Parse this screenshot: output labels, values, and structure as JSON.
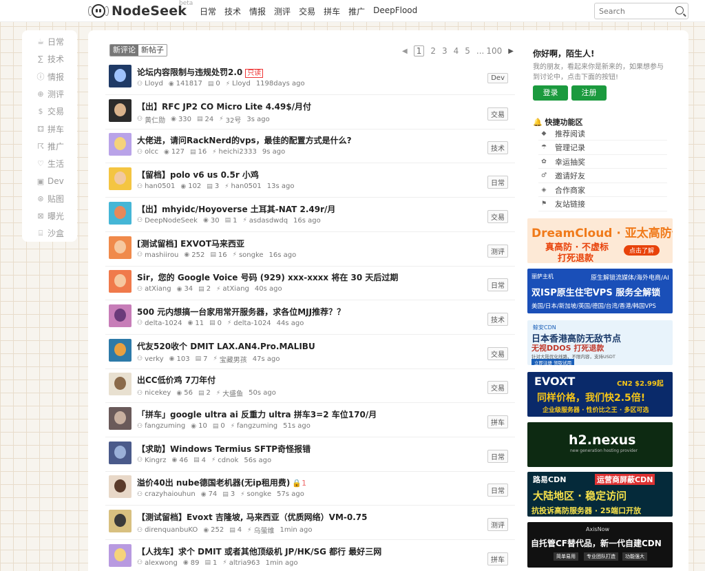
{
  "header": {
    "logo": "NodeSeek",
    "beta": "beta",
    "nav": [
      "日常",
      "技术",
      "情报",
      "测评",
      "交易",
      "拼车",
      "推广",
      "DeepFlood"
    ],
    "search_placeholder": "Search"
  },
  "sidebar": {
    "items": [
      {
        "icon": "☕",
        "label": "日常"
      },
      {
        "icon": "∑",
        "label": "技术"
      },
      {
        "icon": "ⓘ",
        "label": "情报"
      },
      {
        "icon": "⊕",
        "label": "测评"
      },
      {
        "icon": "$",
        "label": "交易"
      },
      {
        "icon": "⚃",
        "label": "拼车"
      },
      {
        "icon": "☈",
        "label": "推广"
      },
      {
        "icon": "♡",
        "label": "生活"
      },
      {
        "icon": "▣",
        "label": "Dev"
      },
      {
        "icon": "⊛",
        "label": "贴图"
      },
      {
        "icon": "⊠",
        "label": "曝光"
      },
      {
        "icon": "⌸",
        "label": "沙盒"
      }
    ]
  },
  "tabs": [
    "新评论",
    "新帖子"
  ],
  "pager": {
    "pages": [
      "1",
      "2",
      "3",
      "4",
      "5"
    ],
    "ellipsis": "...",
    "last": "100"
  },
  "posts": [
    {
      "title": "论坛内容限制与违规处罚2.0",
      "badge": "只读",
      "author": "Lloyd",
      "views": "141817",
      "comments": "0",
      "last": "Lloyd",
      "time": "1198days ago",
      "tag": "Dev",
      "avatar_color": "#1f3a66",
      "avatar_fg": "#9fc3ff"
    },
    {
      "title": "【出】RFC JP2 CO Micro Lite 4.49$/月付",
      "author": "黄仁勋",
      "views": "330",
      "comments": "24",
      "last": "32号",
      "time": "3s ago",
      "tag": "交易",
      "avatar_color": "#2b2b2b",
      "avatar_fg": "#d9b38c"
    },
    {
      "title": "大佬进，请问RackNerd的vps，最佳的配置方式是什么?",
      "author": "olcc",
      "views": "127",
      "comments": "16",
      "last": "heichi2333",
      "time": "9s ago",
      "tag": "技术",
      "avatar_color": "#b9a3e8",
      "avatar_fg": "#f5d37a"
    },
    {
      "title": "【留档】polo v6 us 0.5r 小鸡",
      "author": "han0501",
      "views": "102",
      "comments": "3",
      "last": "han0501",
      "time": "13s ago",
      "tag": "日常",
      "avatar_color": "#f4c542",
      "avatar_fg": "#f2c9a0"
    },
    {
      "title": "【出】mhyidc/Hoyoverse 土耳其-NAT 2.49r/月",
      "author": "DeepNodeSeek",
      "views": "30",
      "comments": "1",
      "last": "asdasdwdq",
      "time": "16s ago",
      "tag": "交易",
      "avatar_color": "#45b6d6",
      "avatar_fg": "#e8885a"
    },
    {
      "title": "[测试留档] EXVOT马来西亚",
      "author": "mashiirou",
      "views": "252",
      "comments": "16",
      "last": "songke",
      "time": "16s ago",
      "tag": "测评",
      "avatar_color": "#f08a4b",
      "avatar_fg": "#f6c8a0"
    },
    {
      "title": "Sir，您的 Google Voice 号码 (929) xxx-xxxx 将在 30 天后过期",
      "author": "atXiang",
      "views": "34",
      "comments": "2",
      "last": "atXiang",
      "time": "40s ago",
      "tag": "日常",
      "avatar_color": "#f07a4b",
      "avatar_fg": "#f6c8a0"
    },
    {
      "title": "500 元内想搞一台家用常开服务器，求各位MJJ推荐？？",
      "author": "delta-1024",
      "views": "11",
      "comments": "0",
      "last": "delta-1024",
      "time": "44s ago",
      "tag": "技术",
      "avatar_color": "#c77db8",
      "avatar_fg": "#6b3b7a"
    },
    {
      "title": "代友520收个 DMIT LAX.AN4.Pro.MALIBU",
      "author": "verky",
      "views": "103",
      "comments": "7",
      "last": "宝藏男孩",
      "time": "47s ago",
      "tag": "交易",
      "avatar_color": "#2d7aa8",
      "avatar_fg": "#e8a040"
    },
    {
      "title": "出CC低价鸡 7刀年付",
      "author": "nicekey",
      "views": "56",
      "comments": "2",
      "last": "大盛鱼",
      "time": "50s ago",
      "tag": "交易",
      "avatar_color": "#e8e0d0",
      "avatar_fg": "#8a6a4a"
    },
    {
      "title": "「拼车」google ultra ai 反重力 ultra 拼车3=2 车位170/月",
      "author": "fangzuming",
      "views": "10",
      "comments": "0",
      "last": "fangzuming",
      "time": "51s ago",
      "tag": "拼车",
      "avatar_color": "#6a5a5a",
      "avatar_fg": "#c8b0a0"
    },
    {
      "title": "【求助】Windows Termius SFTP奇怪报错",
      "author": "Kingrz",
      "views": "46",
      "comments": "4",
      "last": "cdnok",
      "time": "56s ago",
      "tag": "日常",
      "avatar_color": "#4a5a8a",
      "avatar_fg": "#9ab0d8"
    },
    {
      "title": "溢价40出 nube德国老机器(无ip租用费)",
      "tip": "🔒1",
      "author": "crazyhaiouhun",
      "views": "74",
      "comments": "3",
      "last": "songke",
      "time": "57s ago",
      "tag": "日常",
      "avatar_color": "#e8d8c8",
      "avatar_fg": "#5a3a2a"
    },
    {
      "title": "【测试留档】Evoxt 吉隆坡, 马来西亚（优质网络）VM-0.75",
      "author": "direnquanbuKO",
      "views": "252",
      "comments": "4",
      "last": "乌萤维",
      "time": "1min ago",
      "tag": "测评",
      "avatar_color": "#d8c080",
      "avatar_fg": "#3a3a3a"
    },
    {
      "title": "【人找车】求个 DMIT 或者其他顶级机 JP/HK/SG 都行 最好三网",
      "author": "alexwong",
      "views": "89",
      "comments": "1",
      "last": "altria963",
      "time": "1min ago",
      "tag": "拼车",
      "avatar_color": "#b89ae0",
      "avatar_fg": "#f5d37a"
    }
  ],
  "welcome": {
    "title": "你好啊，陌生人!",
    "text": "我的朋友，看起来你是新来的，如果想参与到讨论中，点击下面的按钮!",
    "login": "登录",
    "register": "注册"
  },
  "quick": {
    "title": "快捷功能区",
    "items": [
      {
        "icon": "◆",
        "label": "推荐阅读"
      },
      {
        "icon": "☂",
        "label": "管理记录"
      },
      {
        "icon": "✿",
        "label": "幸运抽奖"
      },
      {
        "icon": "♂",
        "label": "邀请好友"
      },
      {
        "icon": "◈",
        "label": "合作商家"
      },
      {
        "icon": "⚑",
        "label": "友站链接"
      }
    ]
  },
  "ads": [
    {
      "l1": "DreamCloud · 亚太高防云",
      "l2": "真高防 · 不虚标",
      "l3": "打死退款",
      "l4": "点击了解",
      "bg": "#fde9d6",
      "c1": "#f07a1a",
      "c2": "#e8420a"
    },
    {
      "l1": "丽萨主机",
      "l1b": "原生解锁流媒体/海外电商/AI",
      "l2": "双ISP原生住宅VPS  服务全解锁",
      "l3": "美国/日本/新加坡/英国/德国/台湾/香港/韩国VPS",
      "bg": "#1a4fb8",
      "c1": "#fff",
      "c2": "#fff"
    },
    {
      "l1": "鲸安CDN",
      "l2": "日本香港高防无敌节点",
      "l3": "无视DDOS 打死退款",
      "l4": "针对大陆优化线路，不限内容，支持USDT",
      "l5": "立即注册 领取试用",
      "bg": "#e8f3fb",
      "c1": "#1a5fb8",
      "c2": "#1a3a6a"
    },
    {
      "l1": "EVOXT",
      "l1b": "CN2 $2.99起",
      "l2": "同样价格，我们快2.5倍!",
      "l3": "企业级服务器 · 性价比之王 · 多区可选",
      "bg": "#0a2a6a",
      "c1": "#fff",
      "c2": "#f5c518"
    },
    {
      "l1": "h2.nexus",
      "l2": "new generation hosting provider",
      "bg": "#0d2a12",
      "c1": "#fff",
      "c2": "#4ae06a"
    },
    {
      "l1": "路易CDN",
      "l1b": "运营商屏蔽CDN",
      "l2": "大陆地区 · 稳定访问",
      "l3": "抗投诉高防服务器 · 25端口开放",
      "bg": "#052a3a",
      "c1": "#fff",
      "c2": "#f5e04a"
    },
    {
      "l1": "AxisNow",
      "l2": "自托管CF替代品，新一代自建CDN",
      "l3": "简单易用",
      "l4": "专业团队打造",
      "l5": "功能强大",
      "bg": "#111",
      "c1": "#ddd",
      "c2": "#fff"
    }
  ]
}
